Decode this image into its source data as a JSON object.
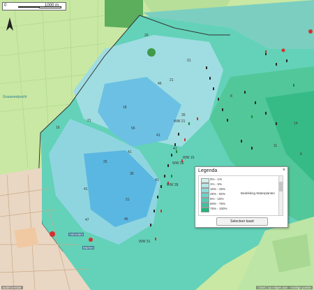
{
  "map": {
    "scalebar": {
      "zero": "0",
      "distance": "1000 m"
    },
    "place_label": "Gouwzeelpocht",
    "depth_labels": [
      "26",
      "21",
      "18",
      "46",
      "21",
      "41",
      "56",
      "41",
      "21",
      "16",
      "26",
      "51",
      "41",
      "46",
      "41",
      "36",
      "41",
      "47",
      "11",
      "14",
      "6",
      "8",
      "25"
    ],
    "marker_labels": [
      "WW 15",
      "WW 21",
      "WW 26",
      "WW 28",
      "WW 31"
    ],
    "town_labels": [
      "Volendam",
      "Marken"
    ],
    "legend": {
      "title": "Legenda",
      "close": "×",
      "layer_name": "Bedekking Waterplanten",
      "items": [
        {
          "label": "0% - 1%",
          "color": "#d6f0ec"
        },
        {
          "label": "1% - 5%",
          "color": "#b6e6e6"
        },
        {
          "label": "15% - 25%",
          "color": "#8fdcd8"
        },
        {
          "label": "25% - 50%",
          "color": "#6ed3c7"
        },
        {
          "label": "5% - 15%",
          "color": "#59c9b6"
        },
        {
          "label": "50% - 75%",
          "color": "#41c09f"
        },
        {
          "label": "75% - 100%",
          "color": "#22b37c"
        }
      ],
      "button": "Selecteer kaart"
    },
    "attribution_left": "actief venster",
    "attribution_right": "Chart | op volgen aan - motilige positie"
  }
}
